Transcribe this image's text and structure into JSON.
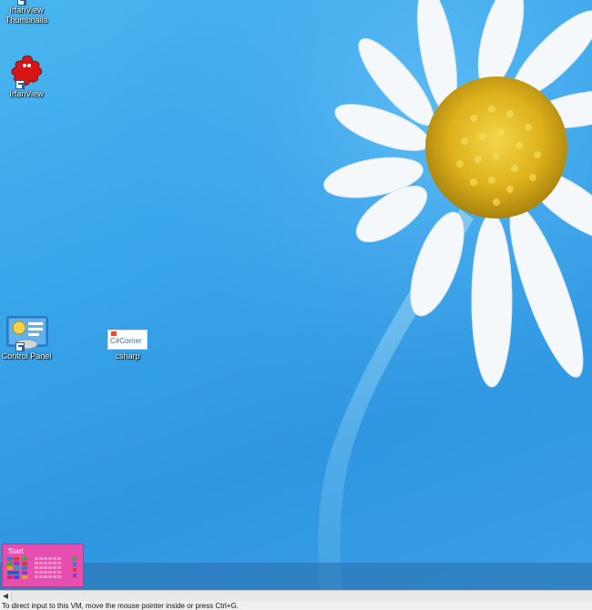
{
  "desktop": {
    "icons": [
      {
        "id": "irfanview-thumbnails",
        "label": "IrfanView\nThumbnails"
      },
      {
        "id": "irfanview",
        "label": "IrfanView"
      },
      {
        "id": "control-panel",
        "label": "Control Panel"
      },
      {
        "id": "csharp",
        "label": "csharp",
        "logo_text": "C#Corner"
      }
    ]
  },
  "taskbar": {
    "start_label": "Start"
  },
  "status_bar": {
    "message": "To direct input to this VM, move the mouse pointer inside or press Ctrl+G."
  },
  "colors": {
    "sky": "#3aa6ea",
    "start_tile": "#e64fb0",
    "daisy_center": "#e2b81a",
    "petal": "#f4f8fa"
  }
}
